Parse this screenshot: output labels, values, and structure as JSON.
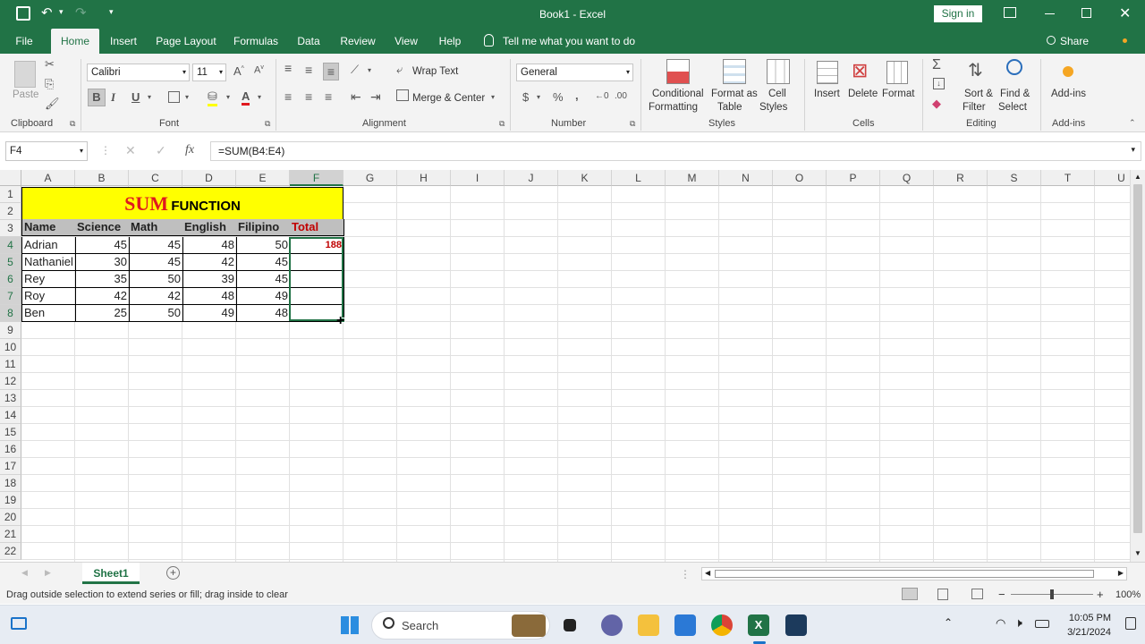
{
  "title": "Book1  -  Excel",
  "signin": "Sign in",
  "tabs": [
    "File",
    "Home",
    "Insert",
    "Page Layout",
    "Formulas",
    "Data",
    "Review",
    "View",
    "Help"
  ],
  "tellme": "Tell me what you want to do",
  "share": "Share",
  "ribbon": {
    "paste": "Paste",
    "clipboard": "Clipboard",
    "font_name": "Calibri",
    "font_size": "11",
    "font": "Font",
    "wrap": "Wrap Text",
    "merge": "Merge & Center",
    "alignment": "Alignment",
    "numfmt": "General",
    "number": "Number",
    "cond1": "Conditional",
    "cond2": "Formatting",
    "fmt1": "Format as",
    "fmt2": "Table",
    "cell1": "Cell",
    "cell2": "Styles",
    "styles": "Styles",
    "insert": "Insert",
    "delete": "Delete",
    "format": "Format",
    "cells": "Cells",
    "sort1": "Sort &",
    "sort2": "Filter",
    "find1": "Find &",
    "find2": "Select",
    "editing": "Editing",
    "addins": "Add-ins",
    "addins_grp": "Add-ins"
  },
  "namebox": "F4",
  "formula": "=SUM(B4:E4)",
  "columns": [
    "A",
    "B",
    "C",
    "D",
    "E",
    "F",
    "G",
    "H",
    "I",
    "J",
    "K",
    "L",
    "M",
    "N",
    "O",
    "P",
    "Q",
    "R",
    "S",
    "T",
    "U"
  ],
  "rows": [
    "1",
    "2",
    "3",
    "4",
    "5",
    "6",
    "7",
    "8",
    "9",
    "10",
    "11",
    "12",
    "13",
    "14",
    "15",
    "16",
    "17",
    "18",
    "19",
    "20",
    "21",
    "22"
  ],
  "banner": {
    "sum": "SUM",
    "function": "FUNCTION"
  },
  "headers": [
    "Name",
    "Science",
    "Math",
    "English",
    "Filipino",
    "Total"
  ],
  "data": [
    {
      "name": "Adrian",
      "science": "45",
      "math": "45",
      "english": "48",
      "filipino": "50",
      "total": "188"
    },
    {
      "name": "Nathaniel",
      "science": "30",
      "math": "45",
      "english": "42",
      "filipino": "45",
      "total": ""
    },
    {
      "name": "Rey",
      "science": "35",
      "math": "50",
      "english": "39",
      "filipino": "45",
      "total": ""
    },
    {
      "name": "Roy",
      "science": "42",
      "math": "42",
      "english": "48",
      "filipino": "49",
      "total": ""
    },
    {
      "name": "Ben",
      "science": "25",
      "math": "50",
      "english": "49",
      "filipino": "48",
      "total": ""
    }
  ],
  "sheet": "Sheet1",
  "status": "Drag outside selection to extend series or fill; drag inside to clear",
  "zoom": "100%",
  "search": "Search",
  "time": "10:05 PM",
  "date": "3/21/2024",
  "colors": {
    "excel_green": "#217346",
    "banner_yellow": "#ffff00",
    "sum_red": "#e0191f",
    "total_red": "#c00000"
  }
}
